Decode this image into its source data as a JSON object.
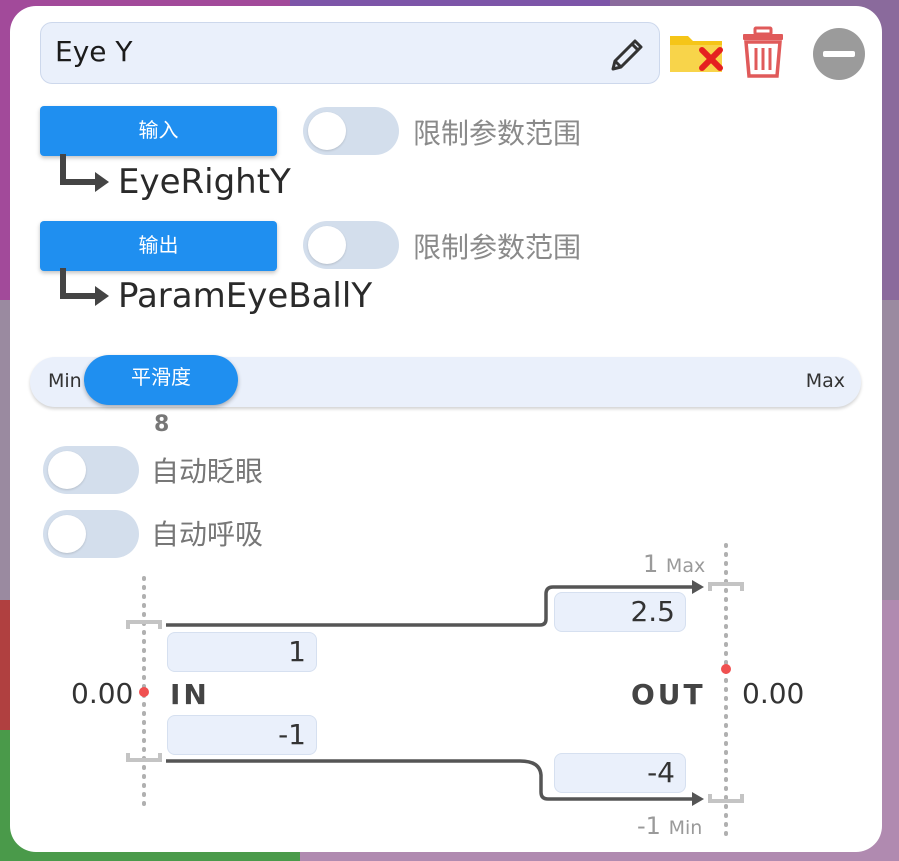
{
  "header": {
    "name": "Eye Y",
    "edit_icon": "pencil-icon",
    "folder_icon": "folder-remove-icon",
    "delete_icon": "trash-icon",
    "collapse_icon": "minus-circle-icon"
  },
  "input": {
    "button_label": "输入",
    "param": "EyeRightY",
    "clamp_label": "限制参数范围",
    "clamp_on": false
  },
  "output": {
    "button_label": "输出",
    "param": "ParamEyeBallY",
    "clamp_label": "限制参数范围",
    "clamp_on": false
  },
  "smoothing": {
    "min_label": "Min",
    "max_label": "Max",
    "thumb_label": "平滑度",
    "value": "8"
  },
  "auto_blink": {
    "label": "自动眨眼",
    "on": false
  },
  "auto_breath": {
    "label": "自动呼吸",
    "on": false
  },
  "mapping": {
    "in_label": "IN",
    "out_label": "OUT",
    "in_value": "0.00",
    "out_value": "0.00",
    "in_max": "1",
    "in_min": "-1",
    "out_max": "2.5",
    "out_min": "-4",
    "out_max_caption_value": "1",
    "out_max_caption_word": "Max",
    "out_min_caption_value": "-1",
    "out_min_caption_word": "Min"
  },
  "colors": {
    "accent": "#1f8ff0",
    "toggle_off": "#d3deec",
    "field_bg": "#eaf0fb",
    "marker_red": "#f05050",
    "trash_red": "#e05a5a"
  }
}
